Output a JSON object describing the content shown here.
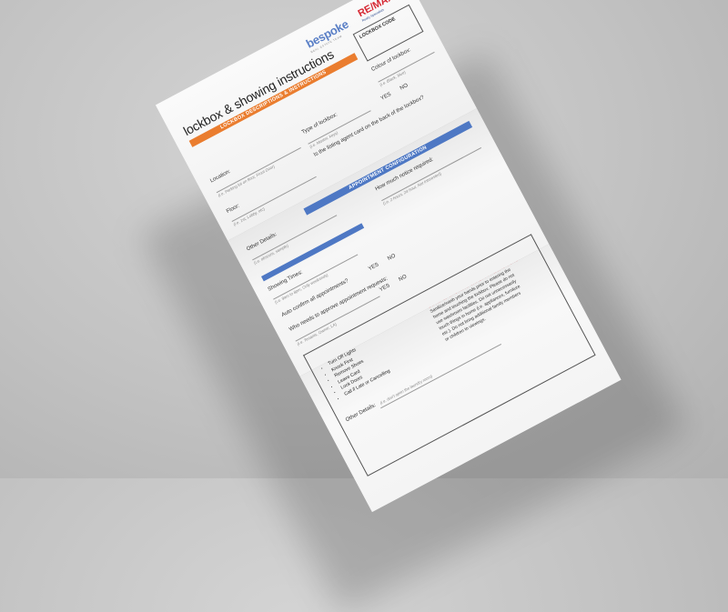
{
  "header": {
    "title": "lockbox & showing instructions",
    "logo_bespoke": "bespoke",
    "logo_bespoke_tag": "REAL ESTATE TEAM",
    "logo_remax": "RE/MAX",
    "logo_remax_sub": "Realty Specialists"
  },
  "lockbox_section": {
    "heading": "LOCKBOX DESCRIPTIONS & INSTRUCTIONS",
    "code_box_label": "LOCKBOX CODE",
    "colour_label": "Colour of lockbox:",
    "colour_hint": "(i.e. Black, blue)",
    "location_label": "Location:",
    "location_hint": "(i.e. Parking lot on floor, Front Door)",
    "type_label": "Type of lockbox:",
    "type_hint": "(i.e. Master, keys)",
    "yes": "YES",
    "no": "NO",
    "floor_label": "Floor:",
    "floor_hint": "(i.e. 1st, Lobby, etc)",
    "card_question": "Is the listing agent card on the back of the lockbox?"
  },
  "appointment_section": {
    "heading": "APPOINTMENT CONFIGURATION",
    "other_details_label": "Other Details:",
    "other_details_hint": "(i.e. obscure, sample)",
    "notice_label": "How much notice required:",
    "notice_hint": "(i.e. 2 hours, 24 hour, Not Interested)",
    "showing_times_label": "Showing Times:",
    "showing_times_hint": "(i.e. 9am to 8pm, Only weekends)",
    "auto_confirm_label": "Auto confirm all appointments?",
    "yes": "YES",
    "no": "NO",
    "who_approve_label": "Who needs to approve appointment requests:",
    "who_approve_hint": "(i.e. Tenants, Owner, LA)",
    "yes2": "YES",
    "no2": "NO"
  },
  "showing_section": {
    "heading": "SHOWING INSTRUCTIONS",
    "covid_title": "COVID-19 SHOWING SAFETY PRECAUTIONS:",
    "covid_text_1": "Sanitize/wash your hands prior to entering the",
    "covid_text_2": "home and touching the lockbox. Please do not",
    "covid_text_3": "use washroom facilities. Do not unnecessarily",
    "covid_text_4": "touch things in home (i.e. appliances, furniture",
    "covid_text_5": "etc.). Do not bring additional family members",
    "covid_text_6": "or children to viewings.",
    "items": [
      "Turn Off Lights",
      "Knock First",
      "Remove Shoes",
      "Leave Card",
      "Lock Doors",
      "Call if Late or Cancelling"
    ],
    "other_label": "Other Details:",
    "other_hint": "(i.e. don't open the laundry room)"
  },
  "colors": {
    "orange": "#ea7d2f",
    "blue": "#4e78c4",
    "red": "#e0282d"
  }
}
